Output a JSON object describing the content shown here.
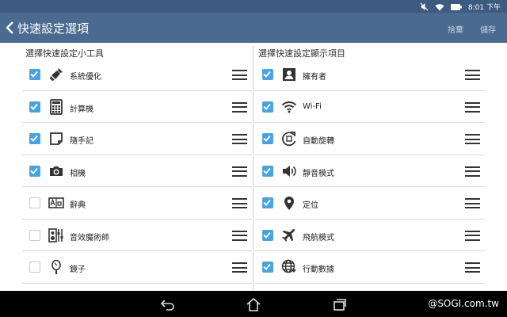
{
  "status_bar": {
    "time": "8:01 下午"
  },
  "app_bar": {
    "title": "快速設定選項",
    "discard_label": "捨棄",
    "save_label": "儲存"
  },
  "left_panel": {
    "header": "選擇快速設定小工具",
    "items": [
      {
        "label": "系統優化",
        "checked": true,
        "icon": "broom-icon"
      },
      {
        "label": "計算機",
        "checked": true,
        "icon": "calculator-icon"
      },
      {
        "label": "隨手記",
        "checked": true,
        "icon": "note-icon"
      },
      {
        "label": "相機",
        "checked": true,
        "icon": "camera-icon"
      },
      {
        "label": "辭典",
        "checked": false,
        "icon": "dictionary-icon"
      },
      {
        "label": "音效魔術師",
        "checked": false,
        "icon": "equalizer-icon"
      },
      {
        "label": "鏡子",
        "checked": false,
        "icon": "mirror-icon"
      }
    ]
  },
  "right_panel": {
    "header": "選擇快速設定顯示項目",
    "items": [
      {
        "label": "擁有者",
        "checked": true,
        "icon": "owner-icon"
      },
      {
        "label": "Wi-Fi",
        "checked": true,
        "icon": "wifi-icon"
      },
      {
        "label": "自動旋轉",
        "checked": true,
        "icon": "auto-rotate-icon"
      },
      {
        "label": "靜音模式",
        "checked": true,
        "icon": "volume-icon"
      },
      {
        "label": "定位",
        "checked": true,
        "icon": "location-icon"
      },
      {
        "label": "飛航模式",
        "checked": true,
        "icon": "airplane-icon"
      },
      {
        "label": "行動數據",
        "checked": true,
        "icon": "globe-icon"
      }
    ]
  },
  "watermark": "@SOGI.com.tw",
  "colors": {
    "status_bar": "#3d5a80",
    "app_bar": "#4a6a8f",
    "checkbox": "#4aa3df",
    "nav_bar": "#000000"
  }
}
